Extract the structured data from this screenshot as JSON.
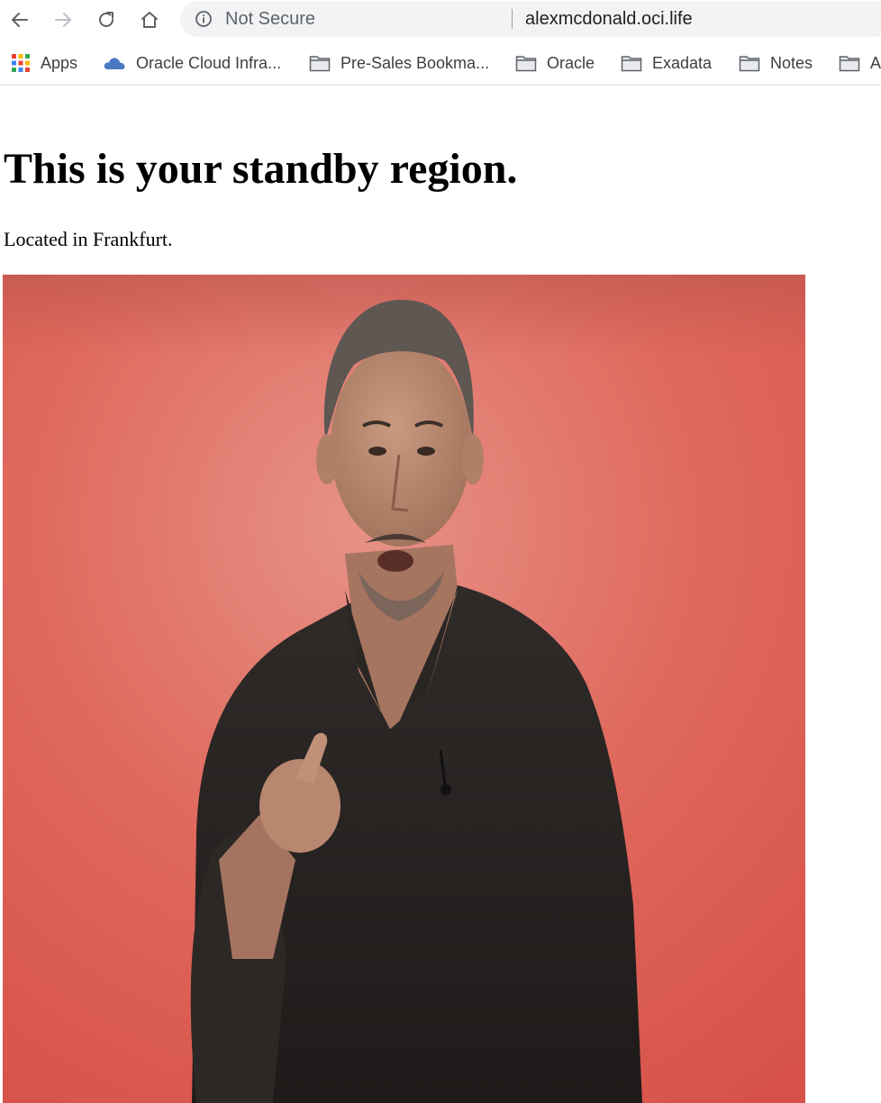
{
  "browser": {
    "security_label": "Not Secure",
    "url": "alexmcdonald.oci.life",
    "nav": {
      "back_icon": "arrow-left-icon",
      "forward_icon": "arrow-right-icon",
      "reload_icon": "reload-icon",
      "home_icon": "home-icon"
    }
  },
  "bookmarks": [
    {
      "label": "Apps",
      "icon": "apps-grid-icon"
    },
    {
      "label": "Oracle Cloud Infra...",
      "icon": "cloud-icon"
    },
    {
      "label": "Pre-Sales Bookma...",
      "icon": "folder-icon"
    },
    {
      "label": "Oracle",
      "icon": "folder-icon"
    },
    {
      "label": "Exadata",
      "icon": "folder-icon"
    },
    {
      "label": "Notes",
      "icon": "folder-icon"
    },
    {
      "label": "A",
      "icon": "folder-icon"
    }
  ],
  "page": {
    "heading": "This is your standby region.",
    "subtext": "Located in Frankfurt."
  },
  "photo": {
    "subject": "man in dark v-neck sweater pointing at viewer",
    "background_color": "#e2584d"
  }
}
